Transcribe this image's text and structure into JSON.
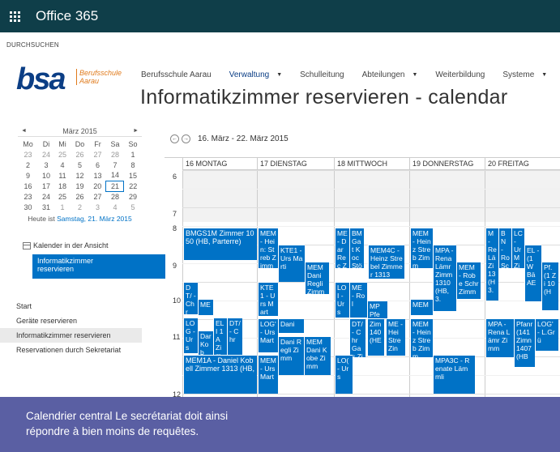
{
  "suite": {
    "app_title": "Office 365",
    "icon": "waffle-icon"
  },
  "ribbon": {
    "browse_label": "DURCHSUCHEN"
  },
  "logo": {
    "text": "bsa",
    "subtitle_line1": "Berufsschule",
    "subtitle_line2": "Aarau"
  },
  "topnav": {
    "items": [
      {
        "label": "Berufsschule Aarau",
        "has_menu": false
      },
      {
        "label": "Verwaltung",
        "has_menu": true,
        "active": true
      },
      {
        "label": "Schulleitung",
        "has_menu": false
      },
      {
        "label": "Abteilungen",
        "has_menu": true
      },
      {
        "label": "Weiterbildung",
        "has_menu": false
      },
      {
        "label": "Systeme",
        "has_menu": true
      }
    ]
  },
  "page_title": "Informatikzimmer reservieren - calendar",
  "datepicker": {
    "month_label": "März 2015",
    "prev_icon": "◄",
    "next_icon": "►",
    "weekdays": [
      "Mo",
      "Di",
      "Mi",
      "Do",
      "Fr",
      "Sa",
      "So"
    ],
    "weeks": [
      [
        "23",
        "24",
        "25",
        "26",
        "27",
        "28",
        "1"
      ],
      [
        "2",
        "3",
        "4",
        "5",
        "6",
        "7",
        "8"
      ],
      [
        "9",
        "10",
        "11",
        "12",
        "13",
        "14",
        "15"
      ],
      [
        "16",
        "17",
        "18",
        "19",
        "20",
        "21",
        "22"
      ],
      [
        "23",
        "24",
        "25",
        "26",
        "27",
        "28",
        "29"
      ],
      [
        "30",
        "31",
        "1",
        "2",
        "3",
        "4",
        "5"
      ]
    ],
    "selected_day": "21",
    "today_prefix": "Heute ist ",
    "today_link": "Samstag, 21. März 2015"
  },
  "calendars_in_view": {
    "heading": "Kalender in der Ansicht",
    "selected_line1": "Informatikzimmer",
    "selected_line2": "reservieren"
  },
  "leftnav": {
    "items": [
      {
        "label": "Start"
      },
      {
        "label": "Geräte reservieren"
      },
      {
        "label": "Informatikzimmer reservieren",
        "active": true
      },
      {
        "label": "Reservationen durch Sekretariat"
      }
    ]
  },
  "calendar": {
    "prev_icon": "←",
    "next_icon": "→",
    "range": "16. März - 22. März 2015",
    "days": [
      "16 MONTAG",
      "17 DIENSTAG",
      "18 MITTWOCH",
      "19 DONNERSTAG",
      "20 FREITAG"
    ],
    "hours": [
      "6",
      "7",
      "8",
      "9",
      "10",
      "11",
      "12"
    ],
    "events": {
      "mon_1": "BMGS1M Zimmer 1050 (HB, Parterre)",
      "mon_2": "DT/ - Chr",
      "mon_3": "ME",
      "mon_4": "LOG - Urs",
      "mon_5": "Dar Kob",
      "mon_6": "ELI 1A Zim",
      "mon_7": "DT/ - Chr",
      "mon_8": "MEM1A - Daniel Kobell Zimmer 1313 (HB,",
      "tue_1": "MEM - Hein: Streb Zimm",
      "tue_2": "KTE1 - Urs Marti",
      "tue_3": "MEM Dani Regli Zimm",
      "tue_4": "KTE1 - Urs Mart",
      "tue_5": "LOG' - Urs Mart",
      "tue_6": "Dani",
      "tue_7": "MEM - Urs Mart",
      "tue_8": "Dani Regli Zimm",
      "tue_9": "MEM Dani Kobe Zimm",
      "wed_1": "ME - Dar Reç Zim",
      "wed_2": "BM Gat Koc Stö",
      "wed_3": "MEM4C - Heinz Strebel Zimmer 1313",
      "wed_4": "LOI - Urs Ma Zim",
      "wed_5": "ME - Rol",
      "wed_6": "MP Pfe",
      "wed_7": "DT/ - Chr Gas Zir",
      "wed_8": "Zim 140 (HE",
      "wed_9": "ME - Hei Stre Zin",
      "wed_10": "LO( - Urs",
      "thu_1": "MEM - Heinz Streb Zimm",
      "thu_2": "MPA - Rena Lämr Zimm 1310 (HB, 3.",
      "thu_3": "MEM - Robe Schr Zimm",
      "thu_4": "MEM - Heinz Streb Zimm",
      "thu_5": "MEM",
      "thu_6": "MPA3C - Renate Lämmli",
      "fri_1": "M - Re Lä Zi 13 (H 3.",
      "fri_2": "BN - Ro Sc Zi",
      "fri_3": "LC - Ur M Zi",
      "fri_4": "EL - (1 W Bä AE",
      "fri_5": "Pf. (1 Zi 10 (H",
      "fri_6": "MPA - Rena Lämr Zimm",
      "fri_7": "Pfanr (141 Zimn 1407 (HB",
      "fri_8": "LOG' - L.Grü"
    }
  },
  "caption": {
    "line1": "Calendrier central Le secrétariat doit ainsi",
    "line2": "répondre à bien moins de requêtes."
  }
}
